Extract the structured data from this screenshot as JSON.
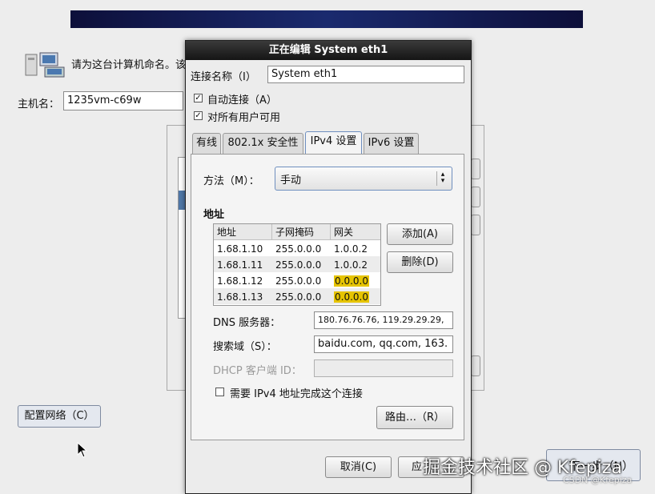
{
  "installer": {
    "prompt": "请为这台计算机命名。该",
    "hostname_label": "主机名：",
    "hostname_value": "1235vm-c69w",
    "config_network_button": "配置网络（C）",
    "next_button": "下一步（N）"
  },
  "dialog": {
    "title": "正在编辑 System eth1",
    "connection_name_label": "连接名称（I）",
    "connection_name_value": "System eth1",
    "auto_connect_label": "自动连接（A）",
    "auto_connect_checked": true,
    "all_users_label": "对所有用户可用",
    "all_users_checked": true,
    "tabs": [
      {
        "label": "有线",
        "active": false
      },
      {
        "label": "802.1x 安全性",
        "active": false
      },
      {
        "label": "IPv4 设置",
        "active": true
      },
      {
        "label": "IPv6 设置",
        "active": false
      }
    ],
    "method_label": "方法（M）：",
    "method_value": "手动",
    "address_section_label": "地址",
    "address_table": {
      "columns": [
        "地址",
        "子网掩码",
        "网关"
      ],
      "rows": [
        {
          "address": "1.68.1.10",
          "netmask": "255.0.0.0",
          "gateway": "1.0.0.2",
          "gateway_highlight": false
        },
        {
          "address": "1.68.1.11",
          "netmask": "255.0.0.0",
          "gateway": "1.0.0.2",
          "gateway_highlight": false
        },
        {
          "address": "1.68.1.12",
          "netmask": "255.0.0.0",
          "gateway": "0.0.0.0",
          "gateway_highlight": true
        },
        {
          "address": "1.68.1.13",
          "netmask": "255.0.0.0",
          "gateway": "0.0.0.0",
          "gateway_highlight": true
        }
      ]
    },
    "add_button": "添加(A)",
    "delete_button": "删除(D)",
    "dns_label": "DNS 服务器：",
    "dns_value": "180.76.76.76, 119.29.29.29,",
    "search_domain_label": "搜索域（S）：",
    "search_domain_value": "baidu.com, qq.com, 163.",
    "dhcp_client_id_label": "DHCP 客户端 ID：",
    "dhcp_client_id_value": "",
    "require_ipv4_label": "需要 IPv4 地址完成这个连接",
    "require_ipv4_checked": false,
    "routes_button": "路由…（R）",
    "cancel_button": "取消(C)",
    "apply_button": "应"
  },
  "watermark": {
    "main": "掘金技术社区 @ Kfepiza",
    "small": "CSDN @Kfepiza"
  }
}
